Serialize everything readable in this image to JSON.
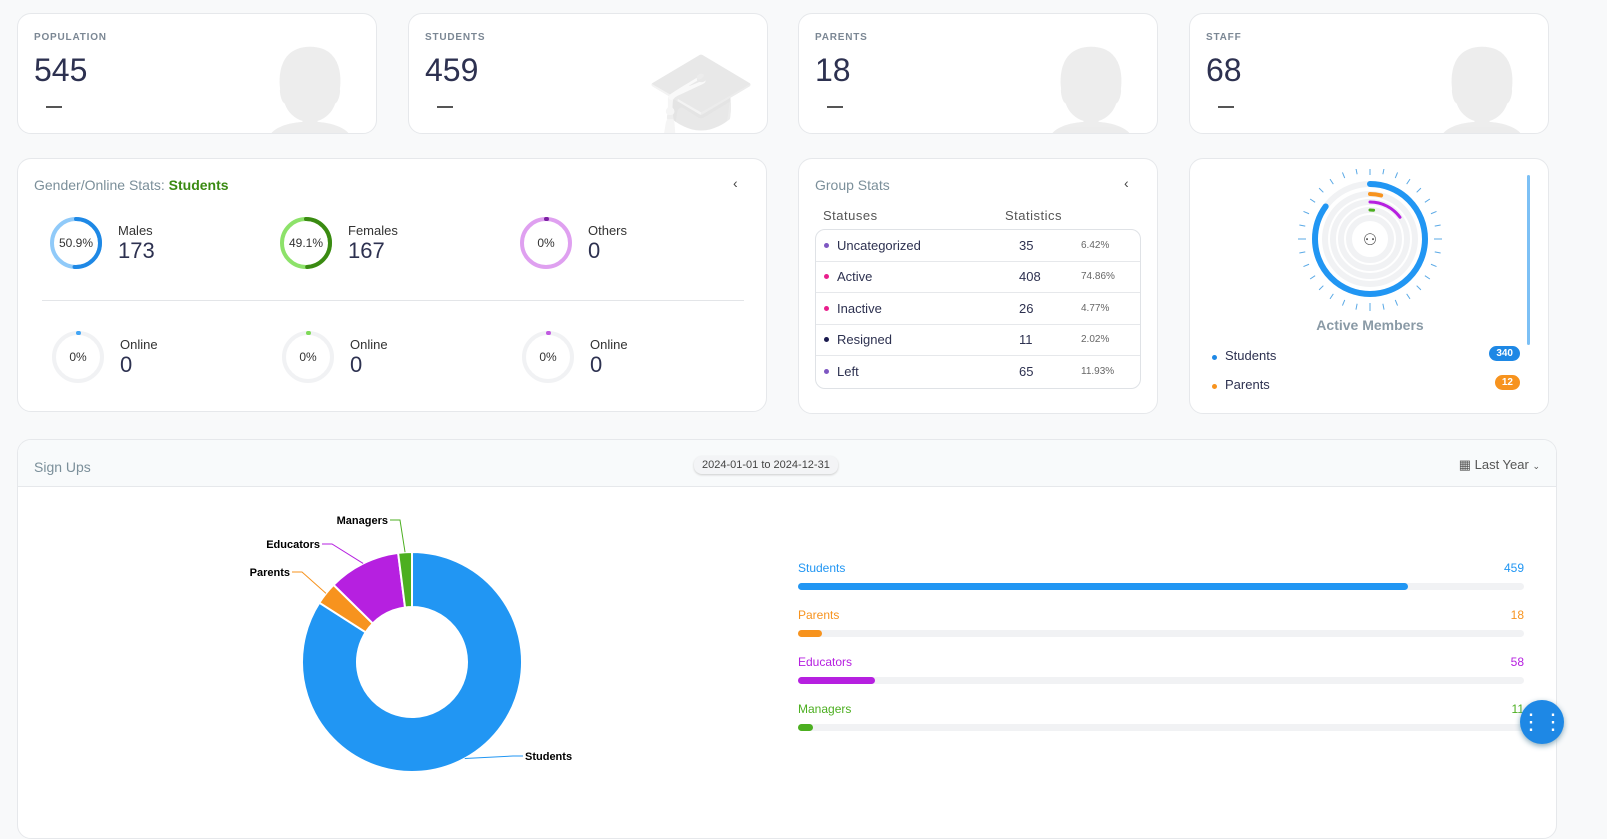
{
  "stats": [
    {
      "label": "POPULATION",
      "value": "545",
      "icon": "users-icon"
    },
    {
      "label": "STUDENTS",
      "value": "459",
      "icon": "graduation-cap-icon"
    },
    {
      "label": "PARENTS",
      "value": "18",
      "icon": "user-shield-icon"
    },
    {
      "label": "STAFF",
      "value": "68",
      "icon": "user-tie-icon"
    }
  ],
  "gender": {
    "title": "Gender/Online Stats: ",
    "group": "Students",
    "items": [
      {
        "label": "Males",
        "value": "173",
        "pct": "50.9%",
        "fraction": 0.509,
        "color": "#1e88e5",
        "track": "#90caf9"
      },
      {
        "label": "Females",
        "value": "167",
        "pct": "49.1%",
        "fraction": 0.491,
        "color": "#3a8a12",
        "track": "#8de26a"
      },
      {
        "label": "Others",
        "value": "0",
        "pct": "0%",
        "fraction": 0,
        "color": "#7b1fa2",
        "track": "#dfa0f0"
      }
    ],
    "online": [
      {
        "label": "Online",
        "value": "0",
        "pct": "0%",
        "color": "#42a5f5"
      },
      {
        "label": "Online",
        "value": "0",
        "pct": "0%",
        "color": "#7ed957"
      },
      {
        "label": "Online",
        "value": "0",
        "pct": "0%",
        "color": "#c05ae0"
      }
    ]
  },
  "group": {
    "title": "Group Stats",
    "col1": "Statuses",
    "col2": "Statistics",
    "rows": [
      {
        "status": "Uncategorized",
        "count": "35",
        "pct": "6.42%",
        "color": "#7e57c2"
      },
      {
        "status": "Active",
        "count": "408",
        "pct": "74.86%",
        "color": "#e91e8c"
      },
      {
        "status": "Inactive",
        "count": "26",
        "pct": "4.77%",
        "color": "#e91e8c"
      },
      {
        "status": "Resigned",
        "count": "11",
        "pct": "2.02%",
        "color": "#1a1a4e"
      },
      {
        "status": "Left",
        "count": "65",
        "pct": "11.93%",
        "color": "#7e57c2"
      }
    ]
  },
  "active": {
    "title": "Active Members",
    "items": [
      {
        "label": "Students",
        "value": "340",
        "color": "#1e88e5"
      },
      {
        "label": "Parents",
        "value": "12",
        "color": "#f7931e"
      }
    ]
  },
  "signups": {
    "title": "Sign Ups",
    "range": "2024-01-01 to 2024-12-31",
    "period": "Last Year"
  },
  "chart_data": {
    "type": "pie",
    "donut": true,
    "categories": [
      "Students",
      "Parents",
      "Educators",
      "Managers"
    ],
    "values": [
      459,
      18,
      58,
      11
    ],
    "colors": [
      "#2196f3",
      "#f7931e",
      "#b620e0",
      "#4caf20"
    ]
  }
}
